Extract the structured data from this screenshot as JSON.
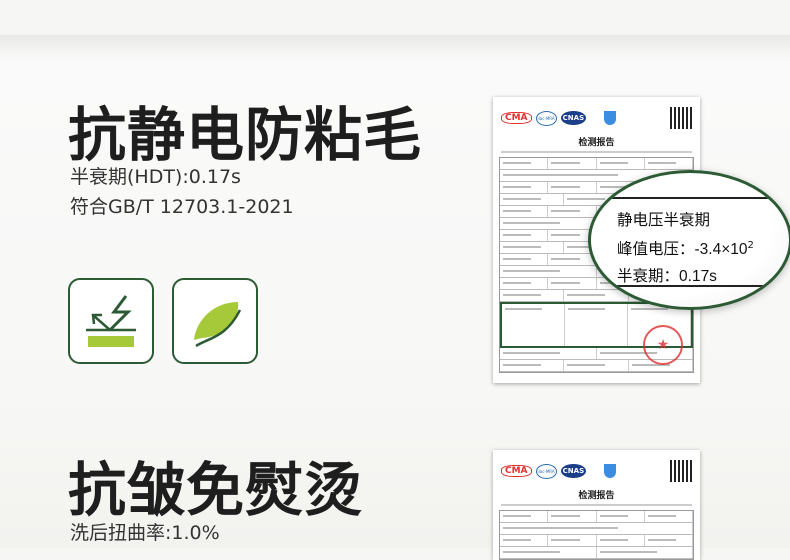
{
  "section1": {
    "title": "抗静电防粘毛",
    "lines": [
      "半衰期(HDT):0.17s",
      "符合GB/T 12703.1-2021"
    ],
    "icons": [
      "anti-static-icon",
      "feather-icon"
    ],
    "report": {
      "title": "检测报告",
      "logos": [
        "CMA",
        "ilac-MRA",
        "CNAS"
      ]
    },
    "magnifier": {
      "heading": "静电压半衰期",
      "peak_label": "峰值电压：",
      "peak_value": "-3.4×10",
      "peak_exp": "2",
      "half_label": "半衰期：",
      "half_value": "0.17s"
    }
  },
  "section2": {
    "title": "抗皱免熨烫",
    "lines": [
      "洗后扭曲率:1.0%"
    ],
    "report": {
      "title": "检测报告",
      "logos": [
        "CMA",
        "ilac-MRA",
        "CNAS"
      ]
    }
  },
  "colors": {
    "dark_green": "#2c5a34",
    "lime": "#a6c93a"
  }
}
